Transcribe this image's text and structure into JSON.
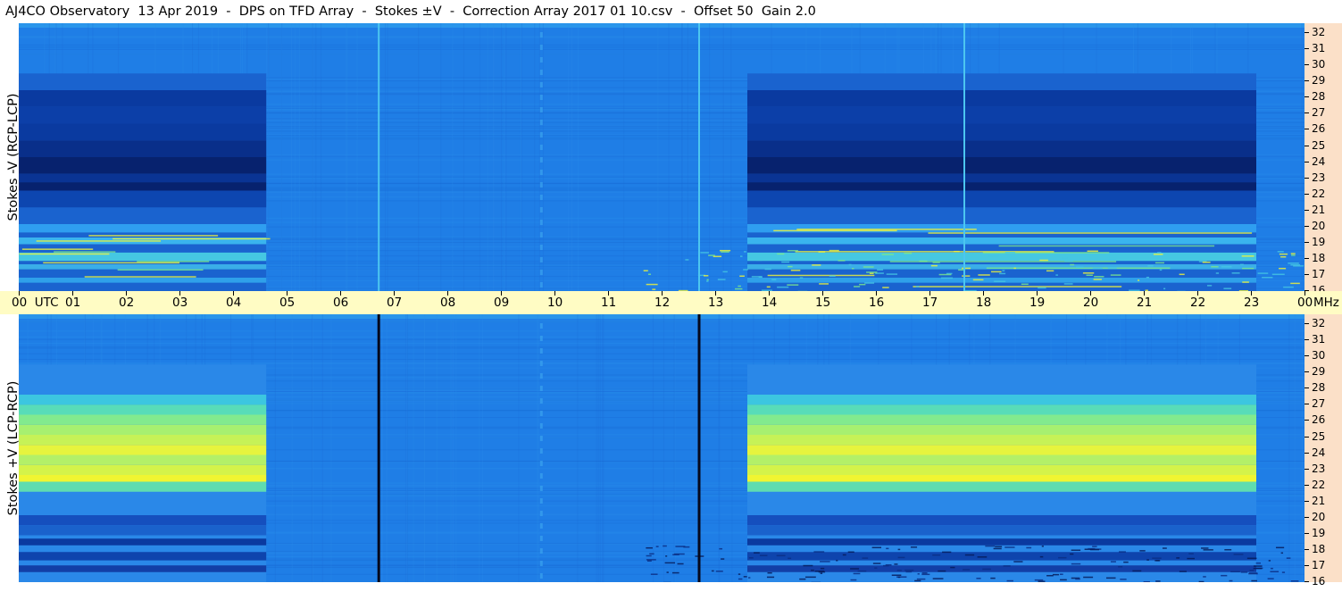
{
  "title": "AJ4CO Observatory  13 Apr 2019  -  DPS on TFD Array  -  Stokes ±V  -  Correction Array 2017 01 10.csv  -  Offset 50  Gain 2.0",
  "colors": {
    "background": "#ffffff",
    "freq_axis_bg": "#fbe0c8",
    "time_axis_bg": "#fffcc4",
    "field_base": "#1f7ee6",
    "field_dark": "#0a3aa0",
    "field_darkest": "#07226e",
    "field_light": "#32a6ee",
    "field_yellow": "#f4f535",
    "field_green": "#7de98a"
  },
  "chart_data": [
    {
      "type": "heatmap",
      "panel": "top",
      "ylabel": "Stokes -V  (RCP-LCP)",
      "x_unit": "UTC",
      "x_range_hours": [
        0,
        24
      ],
      "y_unit": "MHz",
      "y_range_mhz": [
        16,
        32
      ],
      "y_ticks": [
        16,
        17,
        18,
        19,
        20,
        21,
        22,
        23,
        24,
        25,
        26,
        27,
        28,
        29,
        30,
        31,
        32
      ],
      "colormap": "jet (dark blue = negative, yellow = positive)",
      "regions": [
        {
          "t_start": 0.0,
          "t_end": 4.62,
          "f_start": 16.0,
          "f_end": 29.0,
          "level": "mixed: dark 21-28 MHz, lighter bands 16-20 MHz"
        },
        {
          "t_start": 13.6,
          "t_end": 23.1,
          "f_start": 16.0,
          "f_end": 29.0,
          "level": "mixed: darkest 21-28 MHz, green-yellow bands 16-20 MHz"
        }
      ],
      "vertical_lines_utc": [
        6.72,
        12.7,
        17.65
      ]
    },
    {
      "type": "heatmap",
      "panel": "bottom",
      "ylabel": "Stokes +V  (LCP-RCP)",
      "x_unit": "UTC",
      "x_range_hours": [
        0,
        24
      ],
      "y_unit": "MHz",
      "y_range_mhz": [
        16,
        32
      ],
      "y_ticks": [
        16,
        17,
        18,
        19,
        20,
        21,
        22,
        23,
        24,
        25,
        26,
        27,
        28,
        29,
        30,
        31,
        32
      ],
      "colormap": "jet (dark blue = negative, yellow = positive)",
      "regions": [
        {
          "t_start": 0.0,
          "t_end": 4.62,
          "f_start": 16.0,
          "f_end": 29.0,
          "level": "mixed: yellow-green 21-27 MHz, dark bands 16-20 MHz"
        },
        {
          "t_start": 13.6,
          "t_end": 23.1,
          "f_start": 16.0,
          "f_end": 29.0,
          "level": "mixed: yellow-green 21-27 MHz, darkest bands 16-20 MHz"
        }
      ],
      "vertical_lines_utc": [
        6.72,
        12.7
      ]
    }
  ],
  "time_axis": {
    "labels": [
      "00  UTC",
      "01",
      "02",
      "03",
      "04",
      "05",
      "06",
      "07",
      "08",
      "09",
      "10",
      "11",
      "12",
      "13",
      "14",
      "15",
      "16",
      "17",
      "18",
      "19",
      "20",
      "21",
      "22",
      "23",
      "00"
    ],
    "unit_label": "MHz"
  },
  "freq_axis": {
    "labels": [
      "32",
      "31",
      "30",
      "29",
      "28",
      "27",
      "26",
      "25",
      "24",
      "23",
      "22",
      "21",
      "20",
      "19",
      "18",
      "17",
      "16"
    ]
  }
}
